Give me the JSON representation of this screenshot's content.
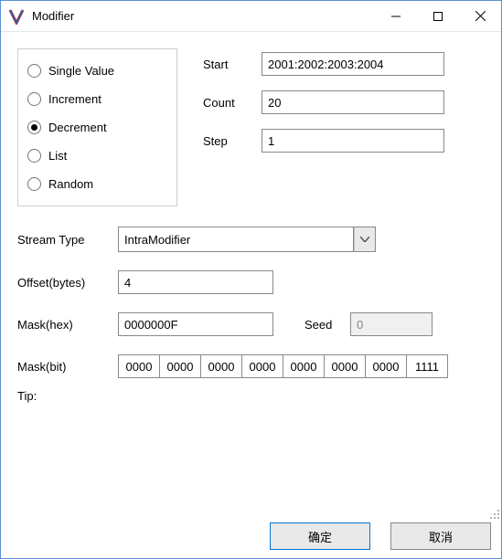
{
  "window": {
    "title": "Modifier"
  },
  "radios": {
    "single": "Single Value",
    "increment": "Increment",
    "decrement": "Decrement",
    "list": "List",
    "random": "Random",
    "selected": "decrement"
  },
  "params": {
    "start_label": "Start",
    "start_value": "2001:2002:2003:2004",
    "count_label": "Count",
    "count_value": "20",
    "step_label": "Step",
    "step_value": "1"
  },
  "form": {
    "stream_type_label": "Stream Type",
    "stream_type_value": "IntraModifier",
    "offset_label": "Offset(bytes)",
    "offset_value": "4",
    "mask_hex_label": "Mask(hex)",
    "mask_hex_value": "0000000F",
    "seed_label": "Seed",
    "seed_value": "0",
    "mask_bit_label": "Mask(bit)",
    "mask_bits": [
      "0000",
      "0000",
      "0000",
      "0000",
      "0000",
      "0000",
      "0000",
      "1111"
    ]
  },
  "tip_label": "Tip:",
  "buttons": {
    "ok": "确定",
    "cancel": "取消"
  }
}
